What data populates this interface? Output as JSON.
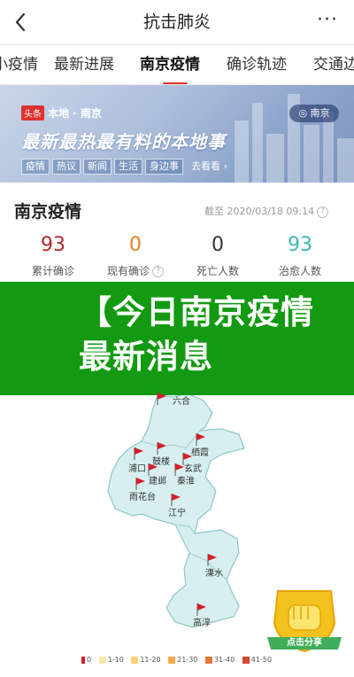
{
  "nav": {
    "title": "抗击肺炎",
    "more": "···"
  },
  "tabs": [
    {
      "label": "小疫情"
    },
    {
      "label": "最新进展"
    },
    {
      "label": "南京疫情"
    },
    {
      "label": "确诊轨迹"
    },
    {
      "label": "交通边"
    }
  ],
  "active_tab": 2,
  "banner": {
    "brand_badge": "头条",
    "brand_text": "本地 · 南京",
    "location": "南京",
    "slogan": "最新最热最有料的本地事",
    "chips": [
      "疫情",
      "热议",
      "新闻",
      "生活",
      "身边事"
    ],
    "more": "去看看 ›"
  },
  "stats": {
    "title": "南京疫情",
    "as_of": "截至 2020/03/18 09:14",
    "items": [
      {
        "value": "93",
        "label": "累计确诊",
        "color": "#b3272d"
      },
      {
        "value": "0",
        "label": "现有确诊",
        "color": "#e8821e"
      },
      {
        "value": "0",
        "label": "死亡人数",
        "color": "#333333"
      },
      {
        "value": "93",
        "label": "治愈人数",
        "color": "#3fb8b8"
      }
    ]
  },
  "overlay": {
    "text": "【今日南京疫情最新消息"
  },
  "map": {
    "districts": [
      "六合",
      "浦口",
      "鼓楼",
      "栖霞",
      "玄武",
      "建邺",
      "秦淮",
      "雨花台",
      "江宁",
      "溧水",
      "高淳"
    ],
    "legend": [
      {
        "label": "0",
        "color": "#e8e8e8"
      },
      {
        "label": "1-10",
        "color": "#ffe8b0"
      },
      {
        "label": "11-20",
        "color": "#ffd27a"
      },
      {
        "label": "21-30",
        "color": "#f6a94f"
      },
      {
        "label": "31-40",
        "color": "#e8783a"
      },
      {
        "label": "41-50",
        "color": "#d44a2a"
      }
    ]
  },
  "share": {
    "label": "点击分享"
  }
}
